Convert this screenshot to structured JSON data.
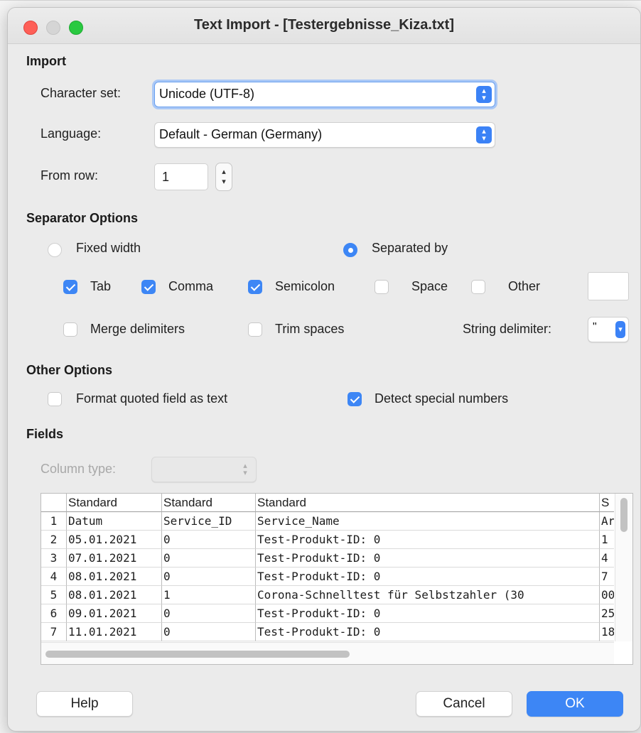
{
  "window": {
    "title": "Text Import - [Testergebnisse_Kiza.txt]"
  },
  "import": {
    "heading": "Import",
    "character_set_label": "Character set:",
    "character_set_value": "Unicode (UTF-8)",
    "language_label": "Language:",
    "language_value": "Default - German (Germany)",
    "from_row_label": "From row:",
    "from_row_value": "1"
  },
  "separator": {
    "heading": "Separator Options",
    "fixed_width_label": "Fixed width",
    "fixed_width_selected": false,
    "separated_by_label": "Separated by",
    "separated_by_selected": true,
    "tab_label": "Tab",
    "tab_checked": true,
    "comma_label": "Comma",
    "comma_checked": true,
    "semicolon_label": "Semicolon",
    "semicolon_checked": true,
    "space_label": "Space",
    "space_checked": false,
    "other_label": "Other",
    "other_checked": false,
    "other_value": "",
    "merge_label": "Merge delimiters",
    "merge_checked": false,
    "trim_label": "Trim spaces",
    "trim_checked": false,
    "string_delim_label": "String delimiter:",
    "string_delim_value": "\""
  },
  "other_options": {
    "heading": "Other Options",
    "quoted_label": "Format quoted field as text",
    "quoted_checked": false,
    "special_label": "Detect special numbers",
    "special_checked": true
  },
  "fields": {
    "heading": "Fields",
    "column_type_label": "Column type:",
    "column_type_value": "",
    "headers": [
      "Standard",
      "Standard",
      "Standard",
      "S"
    ],
    "rows": [
      [
        "1",
        "Datum",
        "Service_ID",
        "Service_Name",
        "Ar"
      ],
      [
        "2",
        "05.01.2021",
        "0",
        "Test-Produkt-ID: 0",
        "1"
      ],
      [
        "3",
        "07.01.2021",
        "0",
        "Test-Produkt-ID: 0",
        "4"
      ],
      [
        "4",
        "08.01.2021",
        "0",
        "Test-Produkt-ID: 0",
        "7"
      ],
      [
        "5",
        "08.01.2021",
        "1",
        "Corona-Schnelltest für Selbstzahler (30",
        "00"
      ],
      [
        "6",
        "09.01.2021",
        "0",
        "Test-Produkt-ID: 0",
        "25"
      ],
      [
        "7",
        "11.01.2021",
        "0",
        "Test-Produkt-ID: 0",
        "18"
      ]
    ]
  },
  "buttons": {
    "help": "Help",
    "cancel": "Cancel",
    "ok": "OK"
  },
  "colors": {
    "accent": "#3d86f5",
    "close": "#fe5f57",
    "maximize": "#29c940"
  }
}
